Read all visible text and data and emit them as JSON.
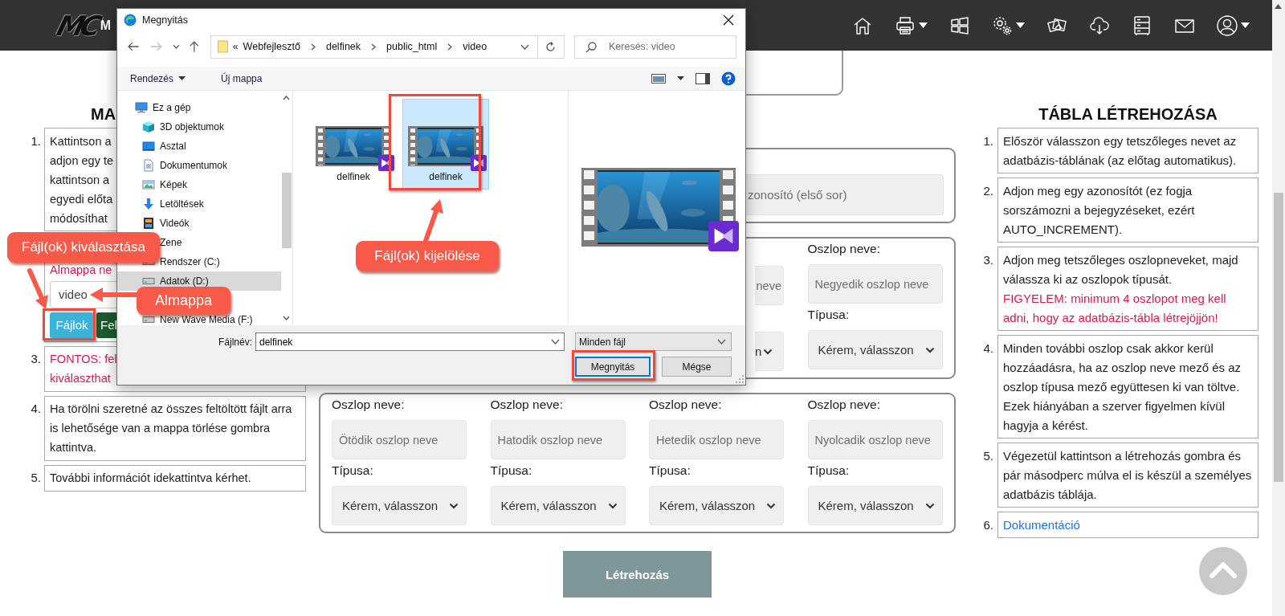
{
  "navbar": {
    "logo": "MC",
    "site_name": "M",
    "items": [
      {
        "kind": "home",
        "dropdown": false
      },
      {
        "kind": "printer",
        "dropdown": true
      },
      {
        "kind": "windows",
        "dropdown": false
      },
      {
        "kind": "settings",
        "dropdown": true
      },
      {
        "kind": "photos",
        "dropdown": false
      },
      {
        "kind": "cloud",
        "dropdown": false
      },
      {
        "kind": "server",
        "dropdown": false
      },
      {
        "kind": "mail",
        "dropdown": false
      },
      {
        "kind": "user",
        "dropdown": true
      }
    ]
  },
  "left_panel": {
    "heading": "MA",
    "steps": [
      {
        "kind": "text",
        "number": "1.",
        "text": "Kattintson a\nadjon egy te\nkattintson a\negyedi előta\nmódosíthat"
      },
      {
        "kind": "upload",
        "label": "Almappa ne",
        "folder": {
          "value": "video"
        },
        "buttons": [
          {
            "kind": "files",
            "label": "Fájlok"
          },
          {
            "kind": "upload",
            "label": "Fel"
          }
        ]
      },
      {
        "kind": "warning",
        "number": "3.",
        "text": "FONTOS: fel\nkiválaszthat"
      },
      {
        "kind": "text",
        "number": "4.",
        "text": "Ha törölni szeretné az összes feltöltött fájlt arra is lehetősége van a mappa törlése gombra kattintva."
      },
      {
        "kind": "text",
        "number": "5.",
        "text": "További információt idekattintva kérhet."
      }
    ]
  },
  "id_panel": {
    "placeholder": "zonosító (első sor)"
  },
  "column_panels": [
    {
      "columns": [
        {
          "kind": "stub",
          "placeholder": "neve",
          "select": "n"
        },
        {
          "kind": "full",
          "label": "Oszlop neve:",
          "placeholder": "Negyedik oszlop neve",
          "type_label": "Típusa:",
          "select": "Kérem, válasszon"
        }
      ]
    },
    {
      "columns": [
        {
          "kind": "full",
          "label": "Oszlop neve:",
          "placeholder": "Ötödik oszlop neve",
          "type_label": "Típusa:",
          "select": "Kérem, válasszon"
        },
        {
          "kind": "full",
          "label": "Oszlop neve:",
          "placeholder": "Hatodik oszlop neve",
          "type_label": "Típusa:",
          "select": "Kérem, válasszon"
        },
        {
          "kind": "full",
          "label": "Oszlop neve:",
          "placeholder": "Hetedik oszlop neve",
          "type_label": "Típusa:",
          "select": "Kérem, válasszon"
        },
        {
          "kind": "full",
          "label": "Oszlop neve:",
          "placeholder": "Nyolcadik oszlop neve",
          "type_label": "Típusa:",
          "select": "Kérem, válasszon"
        }
      ]
    }
  ],
  "create_button": "Létrehozás",
  "right_panel": {
    "heading": "TÁBLA LÉTREHOZÁSA",
    "steps": [
      {
        "number": "1.",
        "text": "Először válasszon egy tetszőleges nevet az adatbázis-táblának (az előtag automatikus)."
      },
      {
        "number": "2.",
        "text": "Adjon meg egy azonosítót (ez fogja sorszámozni a bejegyzéseket, ezért AUTO_INCREMENT)."
      },
      {
        "number": "3.",
        "text": "Adjon meg tetszőleges oszlopneveket, majd válassza ki az oszlopok típusát.",
        "warning": "FIGYELEM: minimum 4 oszlopot meg kell adni, hogy az adatbázis-tábla létrejöjjön!"
      },
      {
        "number": "4.",
        "text": "Minden további oszlop csak akkor kerül hozzáadásra, ha az oszlop neve mező és az oszlop típusa mező együttesen ki van töltve. Ezek hiányában a szerver figyelmen kívül hagyja a kérést."
      },
      {
        "number": "5.",
        "text": "Végezetül kattintson a létrehozás gombra és pár másodperc múlva el is készül a személyes adatbázis táblája."
      },
      {
        "number": "6.",
        "link": "Dokumentáció"
      }
    ]
  },
  "dialog": {
    "title": "Megnyitás",
    "path": {
      "overflow": "«",
      "crumbs": [
        "Webfejlesztő",
        "delfinek",
        "public_html",
        "video"
      ]
    },
    "search": {
      "placeholder": "Keresés: video"
    },
    "toolbar": {
      "organize": "Rendezés",
      "new_folder": "Új mappa"
    },
    "nav_tree": [
      {
        "label": "Ez a gép",
        "kind": "pc",
        "selected": false,
        "children": [
          {
            "label": "3D objektumok",
            "kind": "objects3d",
            "selected": false
          },
          {
            "label": "Asztal",
            "kind": "desktop",
            "selected": false
          },
          {
            "label": "Dokumentumok",
            "kind": "documents",
            "selected": false
          },
          {
            "label": "Képek",
            "kind": "pictures",
            "selected": false
          },
          {
            "label": "Letöltések",
            "kind": "downloads",
            "selected": false
          },
          {
            "label": "Videók",
            "kind": "videos",
            "selected": false
          },
          {
            "label": "Zene",
            "kind": "music",
            "selected": false
          },
          {
            "label": "Rendszer (C:)",
            "kind": "drive",
            "selected": false
          },
          {
            "label": "Adatok (D:)",
            "kind": "drive",
            "selected": true
          },
          {
            "label": "New Wave Media (F:)",
            "kind": "drive",
            "selected": false
          }
        ]
      }
    ],
    "files": [
      {
        "name": "delfinek",
        "selected": false
      },
      {
        "name": "delfinek",
        "selected": true
      }
    ],
    "filename": {
      "label": "Fájlnév:",
      "value": "delfinek"
    },
    "filter": "Minden fájl",
    "buttons": [
      {
        "label": "Megnyitás",
        "default": true
      },
      {
        "label": "Mégse",
        "default": false
      }
    ]
  },
  "annotations": [
    {
      "text": "Fájl(ok) kiválasztása"
    },
    {
      "text": "Almappa"
    },
    {
      "text": "Fájl(ok) kijelölése"
    }
  ]
}
